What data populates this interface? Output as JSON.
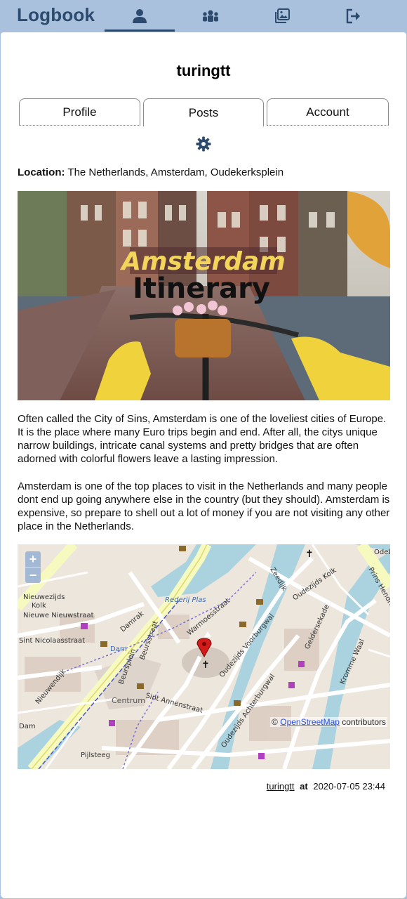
{
  "app": {
    "brand": "Logbook"
  },
  "nav": {
    "items": [
      {
        "name": "profile",
        "icon": "user-icon",
        "active": true
      },
      {
        "name": "friends",
        "icon": "group-icon",
        "active": false
      },
      {
        "name": "gallery",
        "icon": "images-icon",
        "active": false
      },
      {
        "name": "logout",
        "icon": "sign-out-icon",
        "active": false
      }
    ]
  },
  "profile": {
    "username": "turingtt"
  },
  "tabs": [
    {
      "label": "Profile",
      "active": false
    },
    {
      "label": "Posts",
      "active": true
    },
    {
      "label": "Account",
      "active": false
    }
  ],
  "settings": {
    "icon": "gear-icon"
  },
  "post": {
    "location_label": "Location:",
    "location_value": "The Netherlands, Amsterdam, Oudekerksplein",
    "image": {
      "title_line1": "Amsterdam",
      "title_line2": "Itinerary"
    },
    "paragraphs": [
      "Often called the City of Sins, Amsterdam is one of the loveliest cities of Europe. It is the place where many Euro trips begin and end. After all, the citys unique narrow buildings, intricate canal systems and pretty bridges that are often adorned with colorful flowers leave a lasting impression.",
      "Amsterdam is one of the top places to visit in the Netherlands and many people dont end up going anywhere else in the country (but they should). Amsterdam is expensive, so prepare to shell out a lot of money if you are not visiting any other place in the Netherlands."
    ],
    "map": {
      "zoom_in": "+",
      "zoom_out": "−",
      "attribution_prefix": "©",
      "attribution_link": "OpenStreetMap",
      "attribution_suffix": "contributors",
      "labels": {
        "nieuwezijds": "Nieuwezijds",
        "kolk": "Kolk",
        "nieuwe_nieuwstraat": "Nieuwe Nieuwstraat",
        "st_nicolaasstraat": "Sint Nicolaasstraat",
        "dam": "Dam",
        "centrum": "Centrum",
        "damrak": "Damrak",
        "beursplein": "Beursplein",
        "beursstraat": "Beursstraat",
        "warmoesstraat": "Warmoesstraat",
        "oudezijds_voorburgwal": "Oudezijds Voorburgwal",
        "oudezijds_achterburgwal": "Oudezijds Achterburgwal",
        "sint_annenstraat": "Sint Annenstraat",
        "geldersekade": "Geldersekade",
        "kromme_waal": "Kromme Waal",
        "prins_hendrikkade": "Prins Hendrikkade",
        "zeedijk": "Zeedijk",
        "oudezijds_kolk": "Oudezijds Kolk",
        "rederij_plas": "Rederij Plas",
        "pijlsteeg": "Pijlsteeg",
        "nieuwendijk": "Nieuwendijk",
        "odebru": "Odebru"
      }
    },
    "footer": {
      "author": "turingtt",
      "at": "at",
      "timestamp": "2020-07-05 23:44"
    }
  },
  "colors": {
    "nav_bg": "#a9c1dd",
    "brand": "#2c4a6e",
    "accent": "#2c4a6e",
    "link": "#2a4bd7"
  }
}
